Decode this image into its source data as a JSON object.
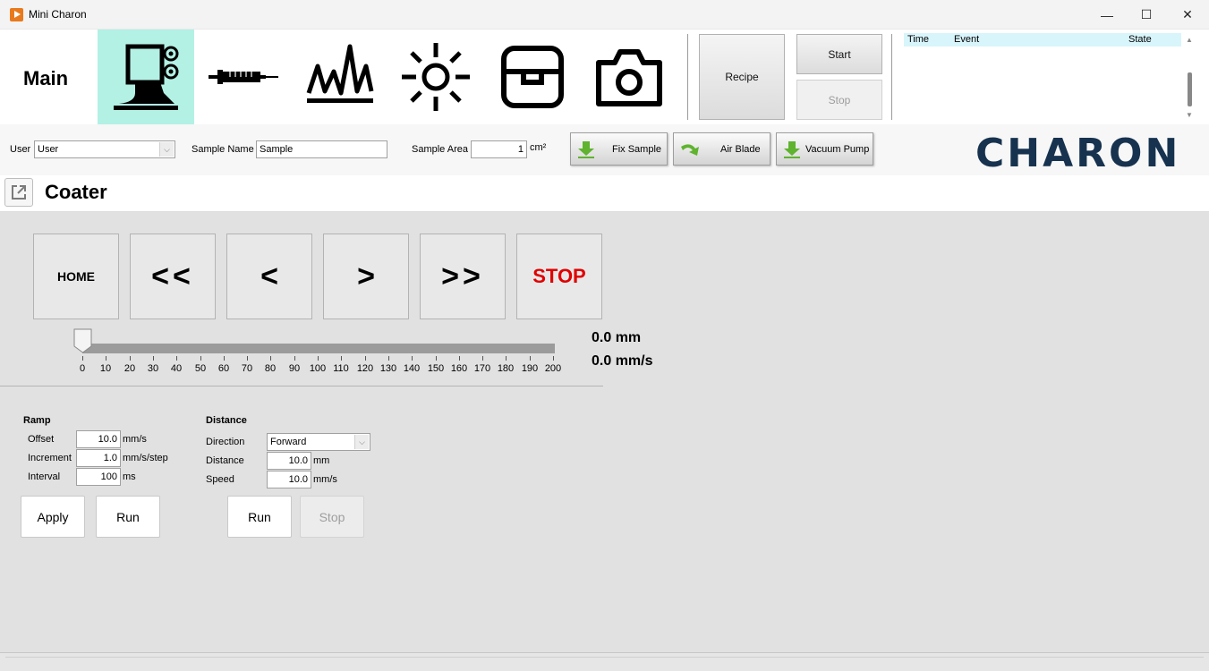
{
  "window": {
    "title": "Mini Charon",
    "controls": {
      "minimize": "—",
      "maximize": "☐",
      "close": "✕"
    }
  },
  "header": {
    "main_label": "Main",
    "nav": [
      {
        "name": "coater-icon",
        "active": true
      },
      {
        "name": "syringe-icon",
        "active": false
      },
      {
        "name": "spectrum-icon",
        "active": false
      },
      {
        "name": "sun-icon",
        "active": false
      },
      {
        "name": "storage-box-icon",
        "active": false
      },
      {
        "name": "camera-icon",
        "active": false
      }
    ],
    "recipe_label": "Recipe",
    "start_label": "Start",
    "stop_label": "Stop"
  },
  "log": {
    "columns": [
      "Time",
      "Event",
      "State"
    ]
  },
  "toolbar": {
    "user_label": "User",
    "user_value": "User",
    "sample_name_label": "Sample Name",
    "sample_name_value": "Sample",
    "sample_area_label": "Sample Area",
    "sample_area_value": "1",
    "sample_area_unit": "cm²",
    "fix_sample_label": "Fix Sample",
    "air_blade_label": "Air Blade",
    "vacuum_pump_label": "Vacuum Pump",
    "logo_text": "CHARON",
    "accent": "#16324f",
    "logo_accent": "#2c8f8c"
  },
  "section": {
    "title": "Coater"
  },
  "jog": {
    "home": "HOME",
    "fast_back": "<<",
    "back": "<",
    "forward": ">",
    "fast_forward": ">>",
    "stop": "STOP",
    "stop_color": "#e00000"
  },
  "slider": {
    "min": 0,
    "max": 200,
    "value": 0,
    "ticks": [
      "0",
      "10",
      "20",
      "30",
      "40",
      "50",
      "60",
      "70",
      "80",
      "90",
      "100",
      "110",
      "120",
      "130",
      "140",
      "150",
      "160",
      "170",
      "180",
      "190",
      "200"
    ]
  },
  "readout": {
    "position": "0.0 mm",
    "speed": "0.0 mm/s"
  },
  "ramp": {
    "title": "Ramp",
    "offset_label": "Offset",
    "offset_value": "10.0",
    "offset_unit": "mm/s",
    "increment_label": "Increment",
    "increment_value": "1.0",
    "increment_unit": "mm/s/step",
    "interval_label": "Interval",
    "interval_value": "100",
    "interval_unit": "ms",
    "apply_label": "Apply",
    "run_label": "Run"
  },
  "distance": {
    "title": "Distance",
    "direction_label": "Direction",
    "direction_value": "Forward",
    "distance_label": "Distance",
    "distance_value": "10.0",
    "distance_unit": "mm",
    "speed_label": "Speed",
    "speed_value": "10.0",
    "speed_unit": "mm/s",
    "run_label": "Run",
    "stop_label": "Stop"
  }
}
